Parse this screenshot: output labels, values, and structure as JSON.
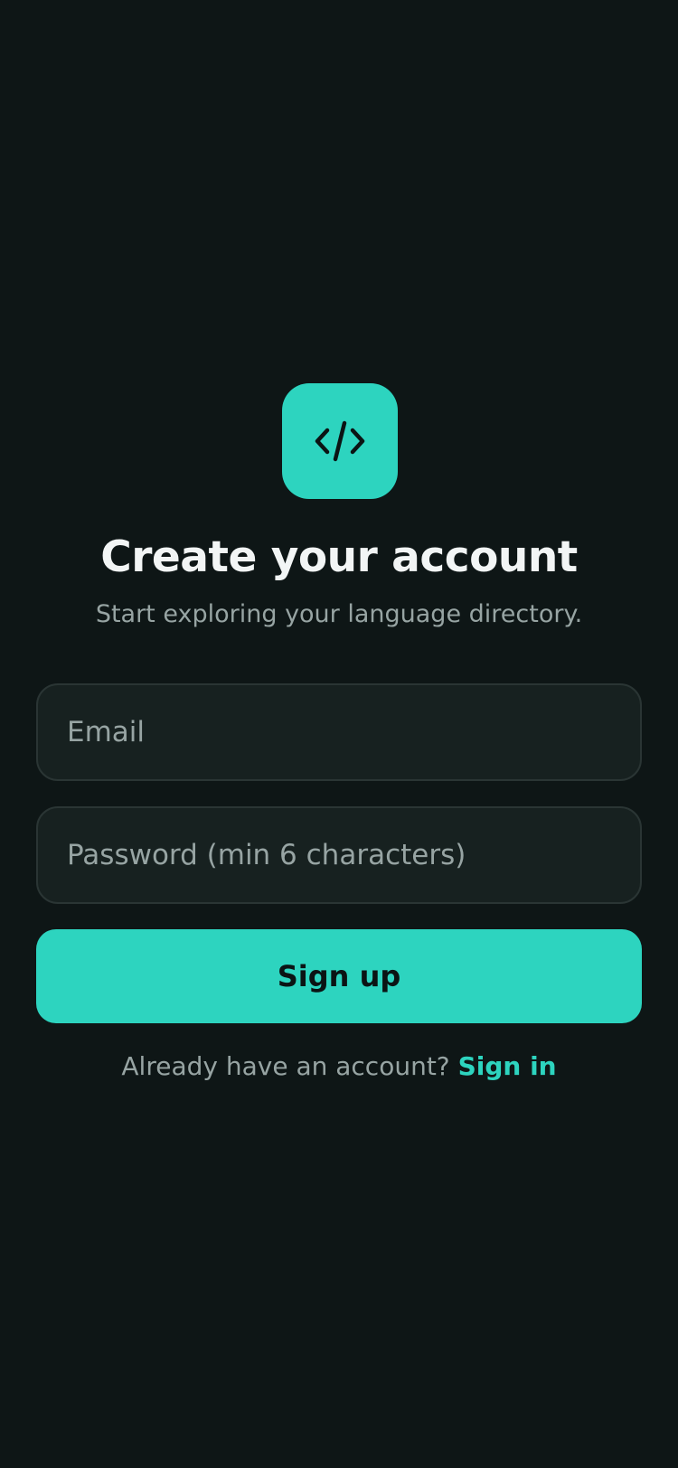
{
  "app_icon": {
    "icon": "code-brackets-icon",
    "color": "#2dd4bf"
  },
  "header": {
    "title": "Create your account",
    "subtitle": "Start exploring your language directory."
  },
  "form": {
    "email_placeholder": "Email",
    "email_value": "",
    "password_placeholder": "Password (min 6 characters)",
    "password_value": "",
    "submit_label": "Sign up"
  },
  "footer": {
    "prompt": "Already have an account?",
    "link_label": "Sign in"
  },
  "colors": {
    "background": "#0e1616",
    "accent": "#2dd4bf",
    "field_background": "#172120",
    "text_primary": "#f2f5f5",
    "text_secondary": "#97a4a3"
  }
}
